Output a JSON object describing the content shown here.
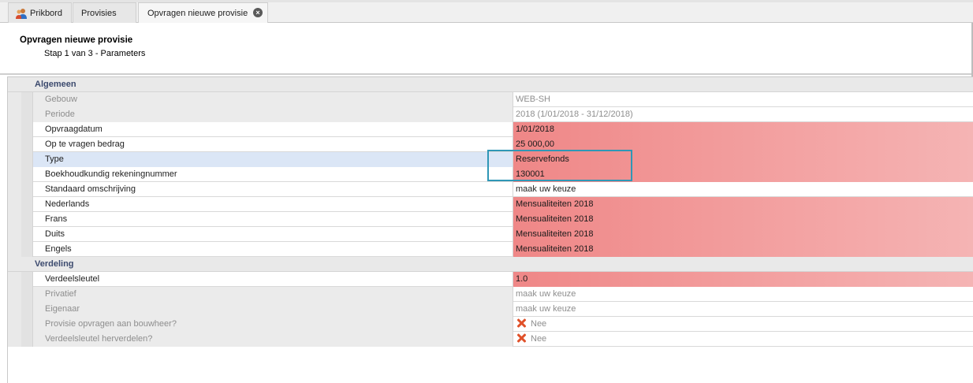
{
  "tabs": [
    {
      "label": "Prikbord",
      "icon": "user-group-icon"
    },
    {
      "label": "Provisies"
    },
    {
      "label": "Opvragen nieuwe provisie",
      "close_icon": "close-icon"
    }
  ],
  "header": {
    "title": "Opvragen nieuwe provisie",
    "subtitle": "Stap 1 van 3 - Parameters"
  },
  "grid": {
    "categories": [
      {
        "label": "Algemeen",
        "rows": [
          {
            "name": "Gebouw",
            "value": "WEB-SH",
            "state": "disabled"
          },
          {
            "name": "Periode",
            "value": "2018 (1/01/2018 - 31/12/2018)",
            "state": "disabled"
          },
          {
            "name": "Opvraagdatum",
            "value": "1/01/2018",
            "state": "required"
          },
          {
            "name": "Op te vragen bedrag",
            "value": "25 000,00",
            "state": "required"
          },
          {
            "name": "Type",
            "value": "Reservefonds",
            "state": "required-selected"
          },
          {
            "name": "Boekhoudkundig rekeningnummer",
            "value": "130001",
            "state": "required"
          },
          {
            "name": "Standaard omschrijving",
            "value": "maak uw keuze",
            "state": "normal"
          },
          {
            "name": "Nederlands",
            "value": "Mensualiteiten 2018",
            "state": "required"
          },
          {
            "name": "Frans",
            "value": "Mensualiteiten 2018",
            "state": "required"
          },
          {
            "name": "Duits",
            "value": "Mensualiteiten 2018",
            "state": "required"
          },
          {
            "name": "Engels",
            "value": "Mensualiteiten 2018",
            "state": "required"
          }
        ]
      },
      {
        "label": "Verdeling",
        "rows": [
          {
            "name": "Verdeelsleutel",
            "value": "1.0",
            "state": "required"
          },
          {
            "name": "Privatief",
            "value": "maak uw keuze",
            "state": "disabled"
          },
          {
            "name": "Eigenaar",
            "value": "maak uw keuze",
            "state": "disabled"
          },
          {
            "name": "Provisie opvragen aan bouwheer?",
            "value": "Nee",
            "state": "disabled",
            "icon": "red-x-icon"
          },
          {
            "name": "Verdeelsleutel herverdelen?",
            "value": "Nee",
            "state": "disabled",
            "icon": "red-x-icon"
          }
        ]
      }
    ]
  },
  "colors": {
    "required_start": "#ef8787",
    "required_end": "#f5b4b4",
    "category_text": "#3c4a6e",
    "focus_border": "#2f97b6",
    "selected_row": "#dbe6f6",
    "x_icon": "#e0512a"
  }
}
